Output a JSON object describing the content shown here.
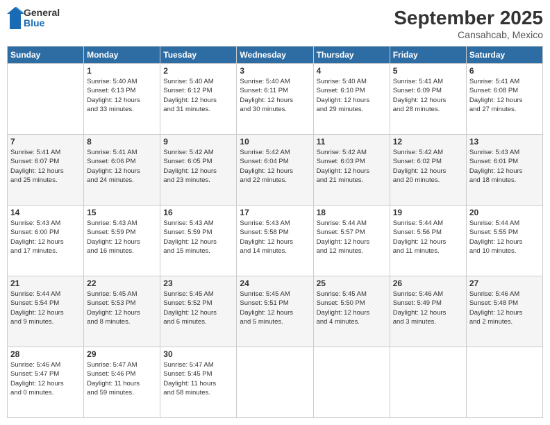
{
  "header": {
    "logo_general": "General",
    "logo_blue": "Blue",
    "month_title": "September 2025",
    "location": "Cansahcab, Mexico"
  },
  "weekdays": [
    "Sunday",
    "Monday",
    "Tuesday",
    "Wednesday",
    "Thursday",
    "Friday",
    "Saturday"
  ],
  "weeks": [
    [
      {
        "day": "",
        "info": ""
      },
      {
        "day": "1",
        "info": "Sunrise: 5:40 AM\nSunset: 6:13 PM\nDaylight: 12 hours\nand 33 minutes."
      },
      {
        "day": "2",
        "info": "Sunrise: 5:40 AM\nSunset: 6:12 PM\nDaylight: 12 hours\nand 31 minutes."
      },
      {
        "day": "3",
        "info": "Sunrise: 5:40 AM\nSunset: 6:11 PM\nDaylight: 12 hours\nand 30 minutes."
      },
      {
        "day": "4",
        "info": "Sunrise: 5:40 AM\nSunset: 6:10 PM\nDaylight: 12 hours\nand 29 minutes."
      },
      {
        "day": "5",
        "info": "Sunrise: 5:41 AM\nSunset: 6:09 PM\nDaylight: 12 hours\nand 28 minutes."
      },
      {
        "day": "6",
        "info": "Sunrise: 5:41 AM\nSunset: 6:08 PM\nDaylight: 12 hours\nand 27 minutes."
      }
    ],
    [
      {
        "day": "7",
        "info": "Sunrise: 5:41 AM\nSunset: 6:07 PM\nDaylight: 12 hours\nand 25 minutes."
      },
      {
        "day": "8",
        "info": "Sunrise: 5:41 AM\nSunset: 6:06 PM\nDaylight: 12 hours\nand 24 minutes."
      },
      {
        "day": "9",
        "info": "Sunrise: 5:42 AM\nSunset: 6:05 PM\nDaylight: 12 hours\nand 23 minutes."
      },
      {
        "day": "10",
        "info": "Sunrise: 5:42 AM\nSunset: 6:04 PM\nDaylight: 12 hours\nand 22 minutes."
      },
      {
        "day": "11",
        "info": "Sunrise: 5:42 AM\nSunset: 6:03 PM\nDaylight: 12 hours\nand 21 minutes."
      },
      {
        "day": "12",
        "info": "Sunrise: 5:42 AM\nSunset: 6:02 PM\nDaylight: 12 hours\nand 20 minutes."
      },
      {
        "day": "13",
        "info": "Sunrise: 5:43 AM\nSunset: 6:01 PM\nDaylight: 12 hours\nand 18 minutes."
      }
    ],
    [
      {
        "day": "14",
        "info": "Sunrise: 5:43 AM\nSunset: 6:00 PM\nDaylight: 12 hours\nand 17 minutes."
      },
      {
        "day": "15",
        "info": "Sunrise: 5:43 AM\nSunset: 5:59 PM\nDaylight: 12 hours\nand 16 minutes."
      },
      {
        "day": "16",
        "info": "Sunrise: 5:43 AM\nSunset: 5:59 PM\nDaylight: 12 hours\nand 15 minutes."
      },
      {
        "day": "17",
        "info": "Sunrise: 5:43 AM\nSunset: 5:58 PM\nDaylight: 12 hours\nand 14 minutes."
      },
      {
        "day": "18",
        "info": "Sunrise: 5:44 AM\nSunset: 5:57 PM\nDaylight: 12 hours\nand 12 minutes."
      },
      {
        "day": "19",
        "info": "Sunrise: 5:44 AM\nSunset: 5:56 PM\nDaylight: 12 hours\nand 11 minutes."
      },
      {
        "day": "20",
        "info": "Sunrise: 5:44 AM\nSunset: 5:55 PM\nDaylight: 12 hours\nand 10 minutes."
      }
    ],
    [
      {
        "day": "21",
        "info": "Sunrise: 5:44 AM\nSunset: 5:54 PM\nDaylight: 12 hours\nand 9 minutes."
      },
      {
        "day": "22",
        "info": "Sunrise: 5:45 AM\nSunset: 5:53 PM\nDaylight: 12 hours\nand 8 minutes."
      },
      {
        "day": "23",
        "info": "Sunrise: 5:45 AM\nSunset: 5:52 PM\nDaylight: 12 hours\nand 6 minutes."
      },
      {
        "day": "24",
        "info": "Sunrise: 5:45 AM\nSunset: 5:51 PM\nDaylight: 12 hours\nand 5 minutes."
      },
      {
        "day": "25",
        "info": "Sunrise: 5:45 AM\nSunset: 5:50 PM\nDaylight: 12 hours\nand 4 minutes."
      },
      {
        "day": "26",
        "info": "Sunrise: 5:46 AM\nSunset: 5:49 PM\nDaylight: 12 hours\nand 3 minutes."
      },
      {
        "day": "27",
        "info": "Sunrise: 5:46 AM\nSunset: 5:48 PM\nDaylight: 12 hours\nand 2 minutes."
      }
    ],
    [
      {
        "day": "28",
        "info": "Sunrise: 5:46 AM\nSunset: 5:47 PM\nDaylight: 12 hours\nand 0 minutes."
      },
      {
        "day": "29",
        "info": "Sunrise: 5:47 AM\nSunset: 5:46 PM\nDaylight: 11 hours\nand 59 minutes."
      },
      {
        "day": "30",
        "info": "Sunrise: 5:47 AM\nSunset: 5:45 PM\nDaylight: 11 hours\nand 58 minutes."
      },
      {
        "day": "",
        "info": ""
      },
      {
        "day": "",
        "info": ""
      },
      {
        "day": "",
        "info": ""
      },
      {
        "day": "",
        "info": ""
      }
    ]
  ]
}
